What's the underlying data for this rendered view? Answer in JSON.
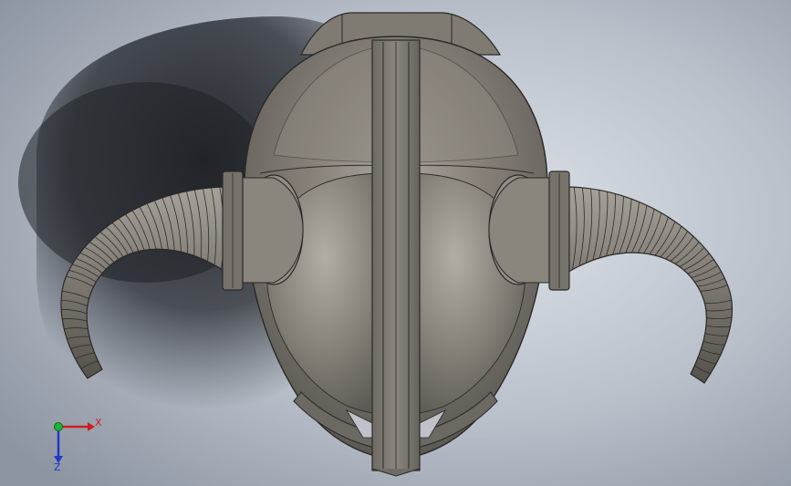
{
  "viewport": {
    "background_colors": {
      "light": "#e4e7ec",
      "mid": "#a9b0bc",
      "dark": "#7d8593"
    },
    "model_colors": {
      "highlight": "#b6b1a8",
      "base": "#7b776f",
      "shade": "#55524d",
      "edge": "#2a2927"
    }
  },
  "triad": {
    "x_label": "X",
    "z_label": "Z",
    "x_color": "#cc1f1f",
    "y_color": "#1fb431",
    "z_color": "#1f39c8"
  }
}
